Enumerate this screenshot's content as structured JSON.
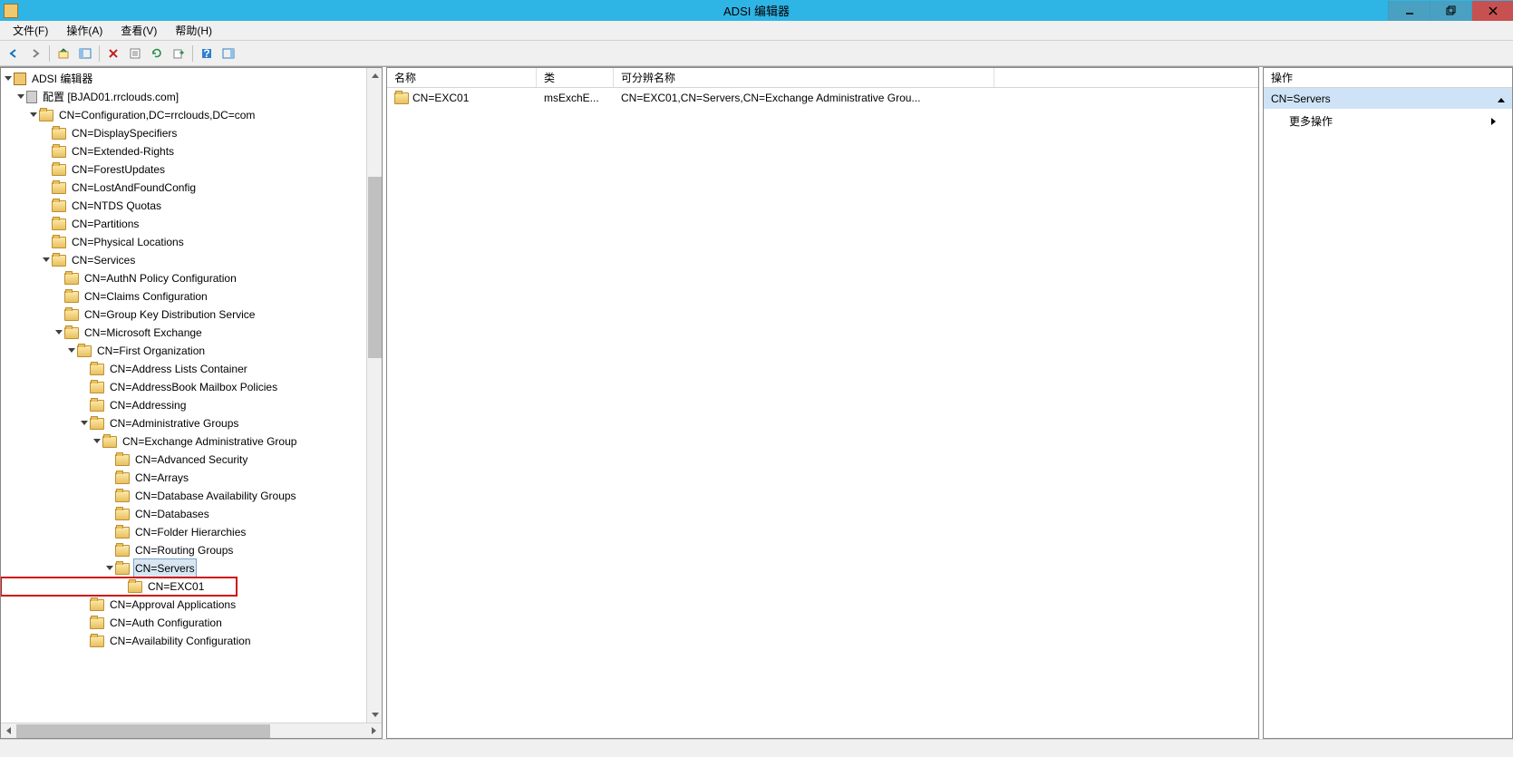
{
  "window": {
    "title": "ADSI 编辑器"
  },
  "menu": {
    "file": "文件(F)",
    "action": "操作(A)",
    "view": "查看(V)",
    "help": "帮助(H)"
  },
  "tree": {
    "root": "ADSI 编辑器",
    "config": "配置 [BJAD01.rrclouds.com]",
    "configuration": "CN=Configuration,DC=rrclouds,DC=com",
    "display_specifiers": "CN=DisplaySpecifiers",
    "extended_rights": "CN=Extended-Rights",
    "forest_updates": "CN=ForestUpdates",
    "lost_and_found": "CN=LostAndFoundConfig",
    "ntds_quotas": "CN=NTDS Quotas",
    "partitions": "CN=Partitions",
    "physical_locations": "CN=Physical Locations",
    "services": "CN=Services",
    "authn_policy": "CN=AuthN Policy Configuration",
    "claims_config": "CN=Claims Configuration",
    "group_key": "CN=Group Key Distribution Service",
    "ms_exchange": "CN=Microsoft Exchange",
    "first_org": "CN=First Organization",
    "address_lists": "CN=Address Lists Container",
    "addressbook_policies": "CN=AddressBook Mailbox Policies",
    "addressing": "CN=Addressing",
    "admin_groups": "CN=Administrative Groups",
    "exchange_admin_group": "CN=Exchange Administrative Group",
    "advanced_security": "CN=Advanced Security",
    "arrays": "CN=Arrays",
    "dag": "CN=Database Availability Groups",
    "databases": "CN=Databases",
    "folder_hierarchies": "CN=Folder Hierarchies",
    "routing_groups": "CN=Routing Groups",
    "servers": "CN=Servers",
    "exc01": "CN=EXC01",
    "approval_apps": "CN=Approval Applications",
    "auth_config": "CN=Auth Configuration",
    "availability_config": "CN=Availability Configuration"
  },
  "list": {
    "headers": {
      "name": "名称",
      "class": "类",
      "dn": "可分辨名称"
    },
    "rows": [
      {
        "name": "CN=EXC01",
        "class": "msExchE...",
        "dn": "CN=EXC01,CN=Servers,CN=Exchange Administrative Grou..."
      }
    ]
  },
  "actions": {
    "header": "操作",
    "section": "CN=Servers",
    "more": "更多操作"
  }
}
